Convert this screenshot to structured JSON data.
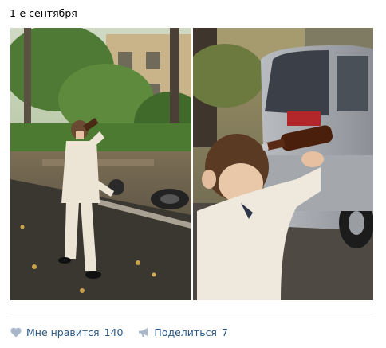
{
  "post": {
    "text": "1-е сентября",
    "photos": [
      {
        "name": "photo-boy-walking-with-bottle"
      },
      {
        "name": "photo-boy-drinking-closeup"
      }
    ]
  },
  "actions": {
    "like": {
      "label": "Мне нравится",
      "count": "140",
      "icon": "heart-icon"
    },
    "share": {
      "label": "Поделиться",
      "count": "7",
      "icon": "megaphone-icon"
    }
  },
  "colors": {
    "link": "#2a5885",
    "icon": "#a8b7ca",
    "divider": "#e7e8ec"
  }
}
